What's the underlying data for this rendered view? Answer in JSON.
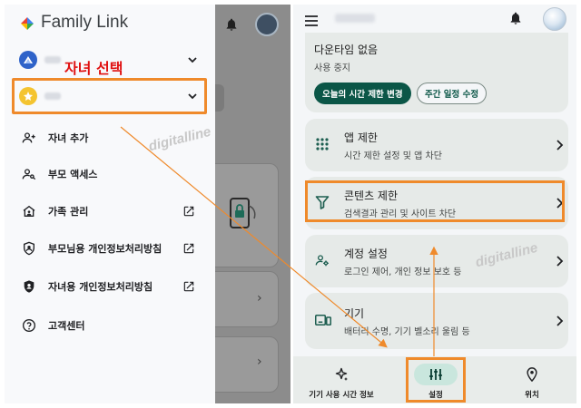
{
  "left": {
    "brand_title": "Family Link",
    "annotation_label": "자녀 선택",
    "menu": [
      {
        "label": "자녀 추가",
        "icon": "add-person-icon"
      },
      {
        "label": "부모 액세스",
        "icon": "parent-access-icon"
      },
      {
        "label": "가족 관리",
        "icon": "family-home-icon",
        "external": true
      },
      {
        "label": "부모님용 개인정보처리방침",
        "icon": "privacy-shield-icon",
        "external": true
      },
      {
        "label": "자녀용 개인정보처리방침",
        "icon": "child-privacy-icon",
        "external": true
      },
      {
        "label": "고객센터",
        "icon": "help-icon"
      }
    ],
    "watermark": "digitalline"
  },
  "right": {
    "downtime": {
      "title": "다운타임 없음",
      "status": "사용 중지",
      "btn_today": "오늘의 시간 제한 변경",
      "btn_week": "주간 일정 수정"
    },
    "settings": [
      {
        "title": "앱 제한",
        "sub": "시간 제한 설정 및 앱 차단",
        "icon": "apps-grid-icon"
      },
      {
        "title": "콘텐츠 제한",
        "sub": "검색결과 관리 및 사이트 차단",
        "icon": "filter-icon"
      },
      {
        "title": "계정 설정",
        "sub": "로그인 제어, 개인 정보 보호 등",
        "icon": "account-settings-icon"
      },
      {
        "title": "기기",
        "sub": "배터리 수명, 기기 벨소리 울림 등",
        "icon": "devices-icon"
      }
    ],
    "nav": [
      {
        "label": "기기 사용 시간 정보",
        "icon": "sparkle-icon"
      },
      {
        "label": "설정",
        "icon": "tune-icon"
      },
      {
        "label": "위치",
        "icon": "location-icon"
      }
    ],
    "watermark": "digitalline"
  },
  "colors": {
    "accent_orange": "#ef8a2b",
    "primary_green": "#0b5647",
    "annotation_red": "#e01010"
  }
}
